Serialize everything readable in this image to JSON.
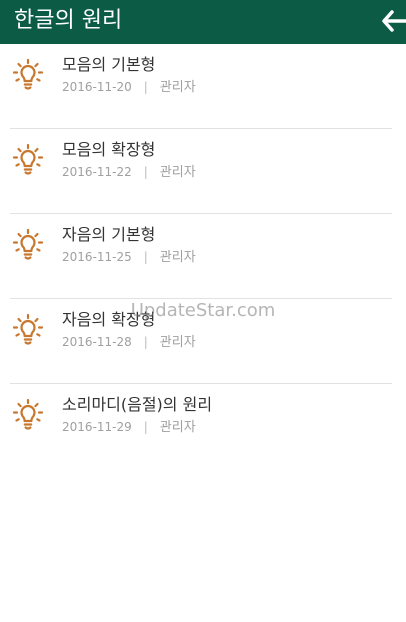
{
  "header": {
    "title": "한글의 원리",
    "back_icon": "arrow-left-icon",
    "background": "#0b5b45"
  },
  "list": {
    "icon": "lightbulb-icon",
    "icon_color": "#c8782e",
    "items": [
      {
        "title": "모음의 기본형",
        "date": "2016-11-20",
        "separator": "|",
        "author": "관리자"
      },
      {
        "title": "모음의 확장형",
        "date": "2016-11-22",
        "separator": "|",
        "author": "관리자"
      },
      {
        "title": "자음의 기본형",
        "date": "2016-11-25",
        "separator": "|",
        "author": "관리자"
      },
      {
        "title": "자음의 확장형",
        "date": "2016-11-28",
        "separator": "|",
        "author": "관리자"
      },
      {
        "title": "소리마디(음절)의 원리",
        "date": "2016-11-29",
        "separator": "|",
        "author": "관리자"
      }
    ]
  },
  "watermark": {
    "text": "UpdateStar.com"
  }
}
